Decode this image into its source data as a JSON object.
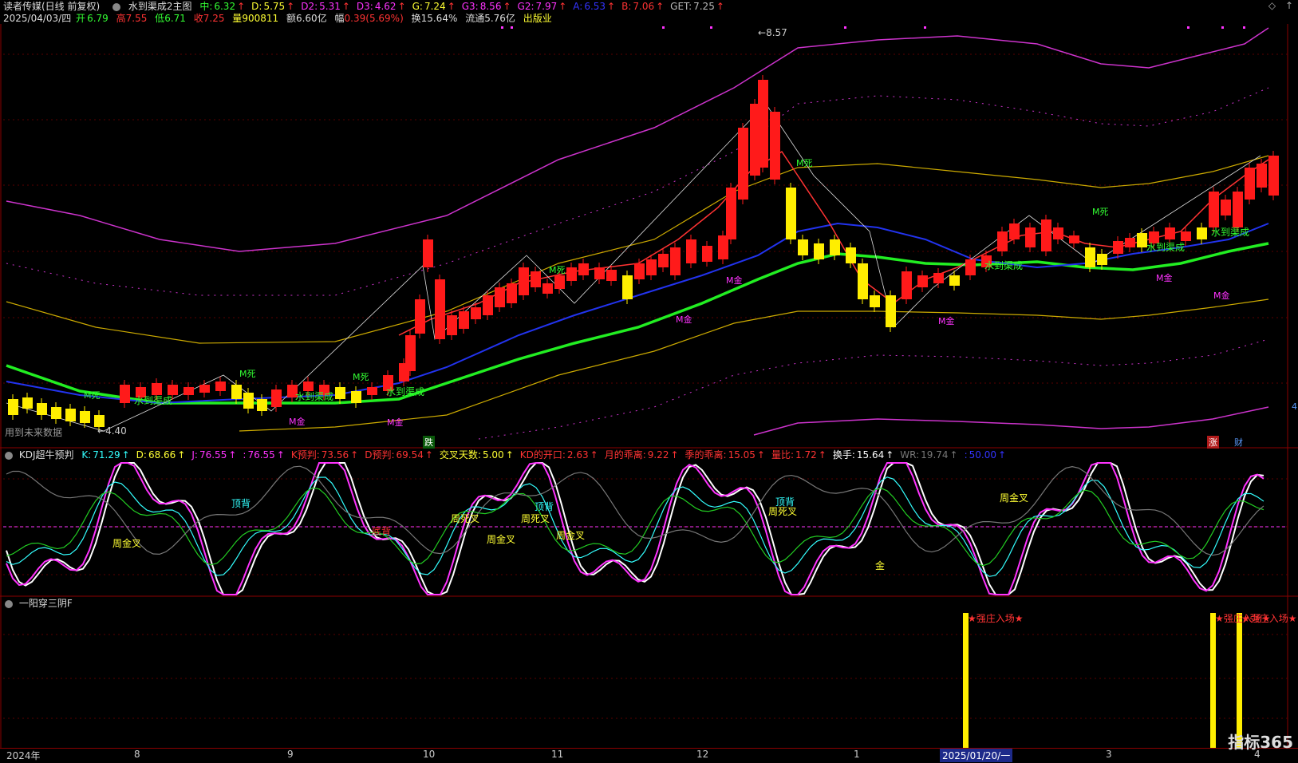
{
  "header": {
    "stock": "读者传媒(日线 前复权)",
    "indicator": "水到渠成2主图",
    "values": [
      {
        "label": "中:",
        "value": "6.32",
        "color": "#33ff33"
      },
      {
        "label": "D:",
        "value": "5.75",
        "color": "#ffff33"
      },
      {
        "label": "D2:",
        "value": "5.31",
        "color": "#ff33ff"
      },
      {
        "label": "D3:",
        "value": "4.62",
        "color": "#ff33ff"
      },
      {
        "label": "G:",
        "value": "7.24",
        "color": "#ffff33"
      },
      {
        "label": "G3:",
        "value": "8.56",
        "color": "#ff33ff"
      },
      {
        "label": "G2:",
        "value": "7.97",
        "color": "#ff33ff"
      },
      {
        "label": "A:",
        "value": "6.53",
        "color": "#3333ff"
      },
      {
        "label": "B:",
        "value": "7.06",
        "color": "#ff3333"
      },
      {
        "label": "GET:",
        "value": "7.25",
        "color": "#bbbbbb"
      }
    ]
  },
  "info_row": {
    "date": "2025/04/03/四",
    "open_label": "开",
    "open": "6.79",
    "high_label": "高",
    "high": "7.55",
    "low_label": "低",
    "low": "6.71",
    "close_label": "收",
    "close": "7.25",
    "volume_label": "量",
    "volume": "900811",
    "amount_label": "额",
    "amount": "6.60亿",
    "change_label": "幅",
    "change": "0.39(5.69%)",
    "turnover_label": "换",
    "turnover": "15.64%",
    "float_label": "流通",
    "float": "5.76亿",
    "sector": "出版业"
  },
  "chart_labels": {
    "price_high": "8.57",
    "price_low": "4.40",
    "future_note": "用到未来数据",
    "zhang": "涨",
    "cai": "财",
    "die": "跌",
    "m_dead": "M死",
    "m_gold": "M金",
    "shuidao": "水到渠成",
    "right_edge": "4"
  },
  "kdj": {
    "title": "KDJ超牛预判",
    "values": [
      {
        "label": "K:",
        "value": "71.29",
        "color": "#33ffff"
      },
      {
        "label": "D:",
        "value": "68.66",
        "color": "#ffff33"
      },
      {
        "label": "J:",
        "value": "76.55",
        "color": "#ff33ff"
      },
      {
        "label": ":",
        "value": "76.55",
        "color": "#ff33ff"
      },
      {
        "label": "K预判:",
        "value": "73.56",
        "color": "#ff3333"
      },
      {
        "label": "D预判:",
        "value": "69.54",
        "color": "#ff3333"
      },
      {
        "label": "交叉天数:",
        "value": "5.00",
        "color": "#ffff33"
      },
      {
        "label": "KD的开口:",
        "value": "2.63",
        "color": "#ff3333"
      },
      {
        "label": "月的乖离:",
        "value": "9.22",
        "color": "#ff3333"
      },
      {
        "label": "季的乖离:",
        "value": "15.05",
        "color": "#ff3333"
      },
      {
        "label": "量比:",
        "value": "1.72",
        "color": "#ff3333"
      },
      {
        "label": "换手:",
        "value": "15.64",
        "color": "#ffffff"
      },
      {
        "label": "WR:",
        "value": "19.74",
        "color": "#777777"
      },
      {
        "label": ":",
        "value": "50.00",
        "color": "#3333ff"
      }
    ],
    "labels": {
      "week_gold": "周金叉",
      "week_dead": "周死叉",
      "top_div": "顶背",
      "bottom_div": "底背",
      "gold": "金"
    }
  },
  "third_panel": {
    "title": "一阳穿三阴F",
    "signal": "★强庄入场★"
  },
  "x_axis": {
    "labels": [
      "2024年",
      "8",
      "9",
      "10",
      "11",
      "12",
      "1",
      "2025/01/20/一",
      "3",
      "4"
    ]
  },
  "logo": "指标365"
}
